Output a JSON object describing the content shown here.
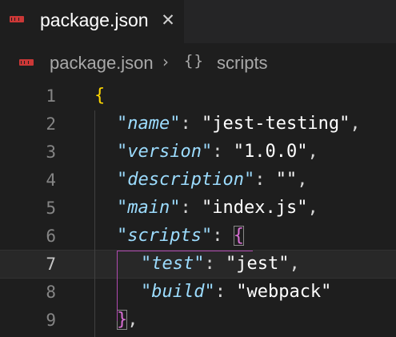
{
  "tab": {
    "title": "package.json",
    "close_glyph": "✕",
    "icon": "npm-icon"
  },
  "breadcrumb": {
    "file": "package.json",
    "separator": "›",
    "symbol_icon": "{}",
    "symbol": "scripts"
  },
  "editor": {
    "active_line": 7,
    "lines": [
      {
        "number": "1",
        "open_brace": "{"
      },
      {
        "number": "2",
        "key": "\"name\"",
        "colon": ": ",
        "value": "\"jest-testing\"",
        "comma": ","
      },
      {
        "number": "3",
        "key": "\"version\"",
        "colon": ": ",
        "value": "\"1.0.0\"",
        "comma": ","
      },
      {
        "number": "4",
        "key": "\"description\"",
        "colon": ": ",
        "value": "\"\"",
        "comma": ","
      },
      {
        "number": "5",
        "key": "\"main\"",
        "colon": ": ",
        "value": "\"index.js\"",
        "comma": ","
      },
      {
        "number": "6",
        "key": "\"scripts\"",
        "colon": ": ",
        "open_brace": "{"
      },
      {
        "number": "7",
        "key": "\"test\"",
        "colon": ": ",
        "value": "\"jest\"",
        "comma": ","
      },
      {
        "number": "8",
        "key": "\"build\"",
        "colon": ": ",
        "value": "\"webpack\""
      },
      {
        "number": "9",
        "close_brace": "}",
        "comma": ","
      }
    ]
  },
  "colors": {
    "background": "#1e1e1e",
    "tabbar": "#252526",
    "key": "#9cdcfe",
    "string": "#ffffff",
    "brace_level1": "#ffd700",
    "brace_level2": "#da70d6",
    "line_number": "#858585",
    "npm_icon": "#cb3837"
  }
}
